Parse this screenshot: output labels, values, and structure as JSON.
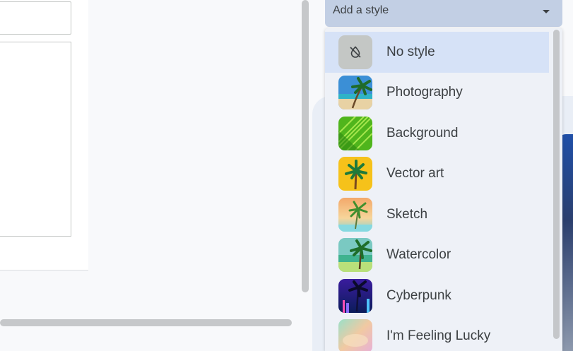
{
  "style_picker": {
    "label": "Add a style",
    "items": [
      {
        "label": "No style",
        "icon": "no-style-icon",
        "selected": true
      },
      {
        "label": "Photography",
        "icon": "photography-thumbnail"
      },
      {
        "label": "Background",
        "icon": "background-thumbnail"
      },
      {
        "label": "Vector art",
        "icon": "vector-art-thumbnail"
      },
      {
        "label": "Sketch",
        "icon": "sketch-thumbnail"
      },
      {
        "label": "Watercolor",
        "icon": "watercolor-thumbnail"
      },
      {
        "label": "Cyberpunk",
        "icon": "cyberpunk-thumbnail"
      },
      {
        "label": "I'm Feeling Lucky",
        "icon": "feeling-lucky-thumbnail"
      }
    ]
  },
  "colors": {
    "select_bg": "#c2cfe4",
    "menu_bg": "#eef1f7",
    "selected_bg": "#d6e2f7",
    "text": "#3c4043"
  }
}
